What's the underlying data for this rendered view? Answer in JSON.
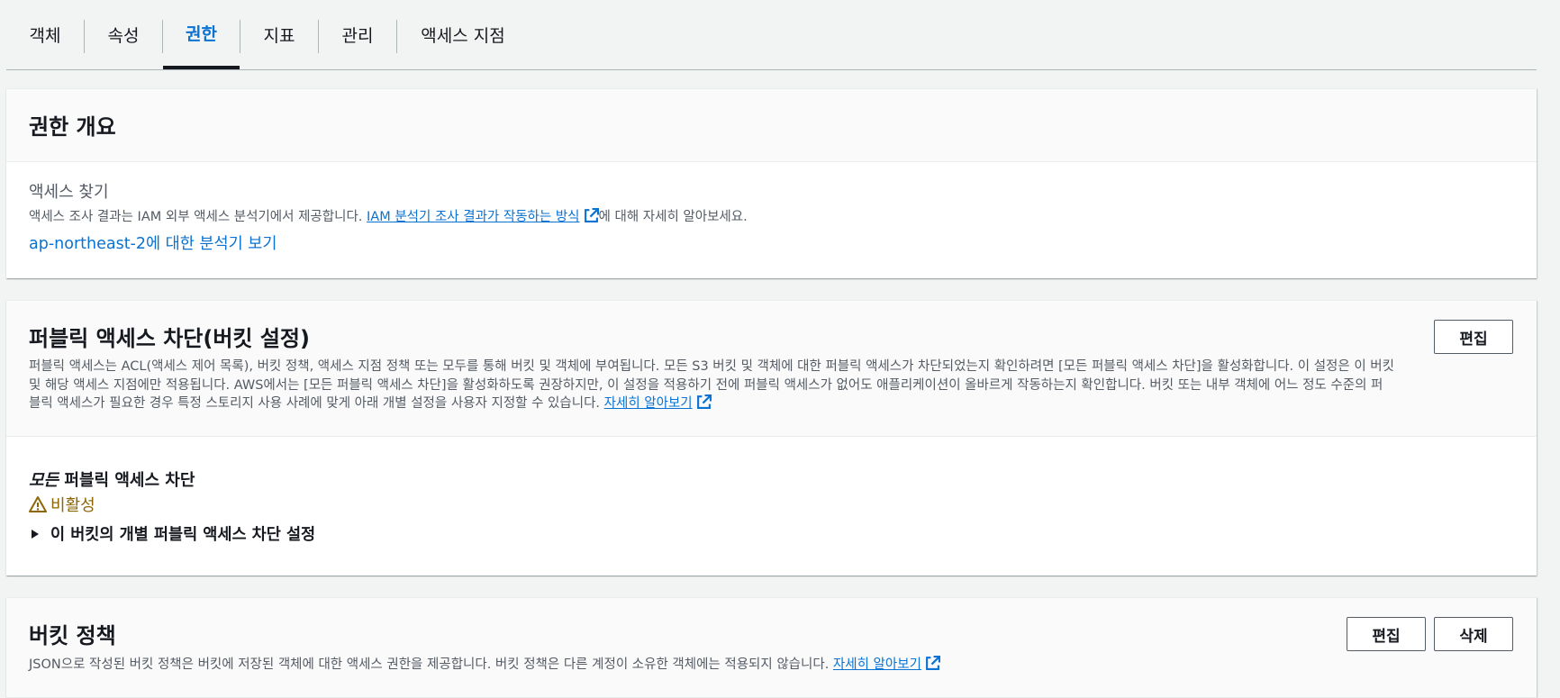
{
  "tabs": [
    {
      "label": "객체"
    },
    {
      "label": "속성"
    },
    {
      "label": "권한"
    },
    {
      "label": "지표"
    },
    {
      "label": "관리"
    },
    {
      "label": "액세스 지점"
    }
  ],
  "overview": {
    "title": "권한 개요",
    "access_finding_label": "액세스 찾기",
    "desc_prefix": "액세스 조사 결과는 IAM 외부 액세스 분석기에서 제공합니다. ",
    "desc_link": "IAM 분석기 조사 결과가 작동하는 방식",
    "desc_suffix": "에 대해 자세히 알아보세요.",
    "analyzer_link": "ap-northeast-2에 대한 분석기 보기"
  },
  "public_access": {
    "title": "퍼블릭 액세스 차단(버킷 설정)",
    "edit_label": "편집",
    "desc_line1": "퍼블릭 액세스는 ACL(액세스 제어 목록), 버킷 정책, 액세스 지점 정책 또는 모두를 통해 버킷 및 객체에 부여됩니다. 모든 S3 버킷 및 객체에 대한 퍼블릭 액세스가 차단되었는지 확인하려면 [모든 퍼블릭 액세스 차단]을 활성화합니다. 이 설정은 이 버킷",
    "desc_line2": "및 해당 액세스 지점에만 적용됩니다. AWS에서는 [모든 퍼블릭 액세스 차단]을 활성화하도록 권장하지만, 이 설정을 적용하기 전에 퍼블릭 액세스가 없어도 애플리케이션이 올바르게 작동하는지 확인합니다. 버킷 또는 내부 객체에 어느 정도 수준의 퍼",
    "desc_line3": "블릭 액세스가 필요한 경우 특정 스토리지 사용 사례에 맞게 아래 개별 설정을 사용자 지정할 수 있습니다. ",
    "learn_more": "자세히 알아보기",
    "block_all_em": "모든",
    "block_all_rest": " 퍼블릭 액세스 차단",
    "status": "비활성",
    "status_color": "#8d6605",
    "expand_label": "이 버킷의 개별 퍼블릭 액세스 차단 설정"
  },
  "bucket_policy": {
    "title": "버킷 정책",
    "edit_label": "편집",
    "delete_label": "삭제",
    "desc": "JSON으로 작성된 버킷 정책은 버킷에 저장된 객체에 대한 액세스 권한을 제공합니다. 버킷 정책은 다른 계정이 소유한 객체에는 적용되지 않습니다. ",
    "learn_more": "자세히 알아보기"
  },
  "icons": {
    "external": "external-link-icon",
    "warning": "warning-icon",
    "caret": "caret-right-icon"
  },
  "colors": {
    "link": "#0972d3",
    "active_tab": "#0972d3",
    "warning": "#8d6605"
  }
}
